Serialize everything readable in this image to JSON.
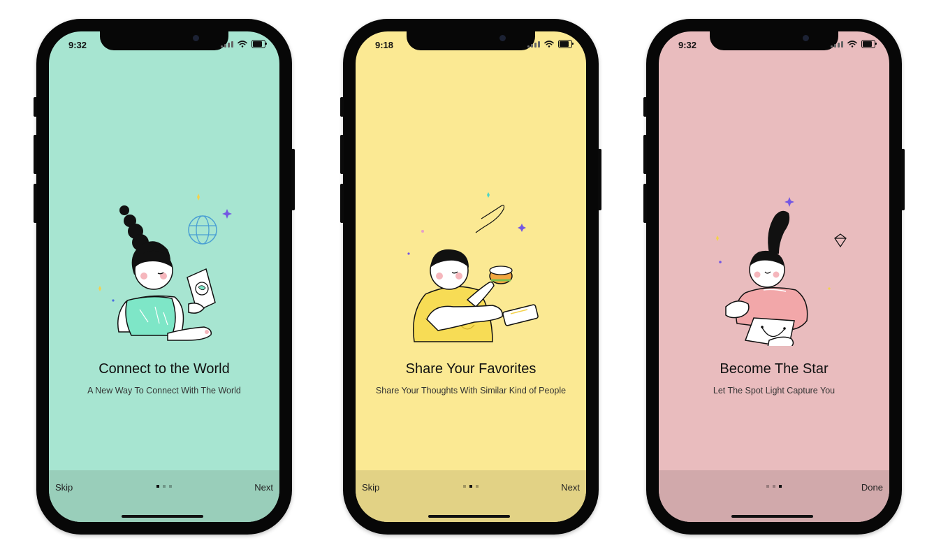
{
  "screens": [
    {
      "time": "9:32",
      "title": "Connect to the World",
      "subtitle": "A New Way To Connect With The World",
      "left_button": "Skip",
      "right_button": "Next",
      "active_dot": 1,
      "page_count": 3,
      "background": "#a7e5d1",
      "bar_color": "#99ceba"
    },
    {
      "time": "9:18",
      "title": "Share Your Favorites",
      "subtitle": "Share Your Thoughts With Similar Kind of People",
      "left_button": "Skip",
      "right_button": "Next",
      "active_dot": 2,
      "page_count": 3,
      "background": "#fbe993",
      "bar_color": "#e2d285"
    },
    {
      "time": "9:32",
      "title": "Become The Star",
      "subtitle": "Let The Spot Light Capture You",
      "left_button": "",
      "right_button": "Done",
      "active_dot": 3,
      "page_count": 3,
      "background": "#e9bcbe",
      "bar_color": "#d1a9ab"
    }
  ]
}
